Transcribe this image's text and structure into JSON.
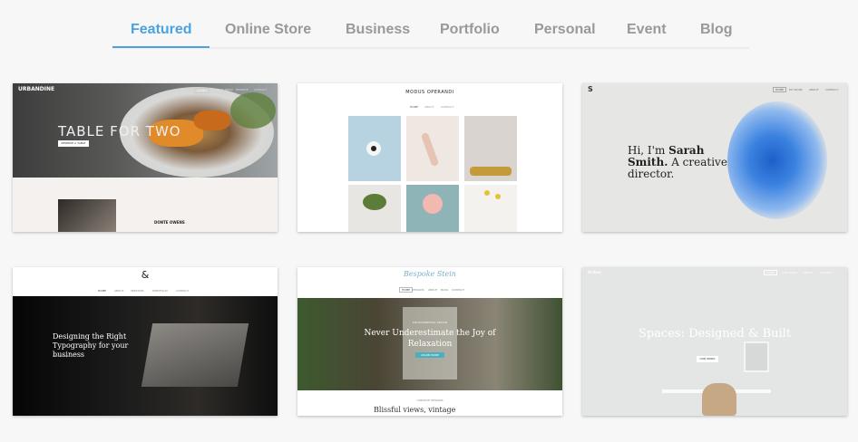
{
  "tabs": [
    {
      "label": "Featured",
      "active": true
    },
    {
      "label": "Online Store"
    },
    {
      "label": "Business"
    },
    {
      "label": "Portfolio"
    },
    {
      "label": "Personal"
    },
    {
      "label": "Event"
    },
    {
      "label": "Blog"
    }
  ],
  "colors": {
    "accent": "#4aa3e0",
    "tab_inactive": "#999999",
    "background": "#f7f7f7"
  },
  "templates": [
    {
      "name": "urbandine",
      "logo": "URBANDINE",
      "headline": "TABLE FOR TWO",
      "nav": [
        "HOME",
        "ABOUT",
        "MENU",
        "RESERVE",
        "CONTACT"
      ],
      "button": "RESERVE A TABLE",
      "subhead": "DONTE OWENS"
    },
    {
      "name": "modus-operandi",
      "logo": "MODUS OPERANDI",
      "nav": [
        "HOME",
        "ABOUT",
        "CONTACT"
      ]
    },
    {
      "name": "sarah",
      "logo": "S",
      "headline_plain": "Hi, I'm ",
      "headline_bold_1": "Sarah",
      "headline_bold_2": "Smith.",
      "headline_rest": "A creative director.",
      "nav": [
        "HOME",
        "MY WORK",
        "ABOUT",
        "CONTACT"
      ]
    },
    {
      "name": "typography",
      "logo": "&",
      "headline": "Designing the Right Typography for your business",
      "nav": [
        "HOME",
        "ABOUT",
        "SERVICES",
        "PORTFOLIO",
        "CONTACT"
      ],
      "caption": "VIEW PROJECTS"
    },
    {
      "name": "bespoke-stein",
      "logo": "Bespoke Stein",
      "headline": "Never Underestimate the Joy of Relaxation",
      "nav": [
        "HOME",
        "DESIGNS",
        "ABOUT",
        "BLOG",
        "CONTACT"
      ],
      "kicker": "ENVIRONMENTAL DESIGN",
      "button": "LEARN MORE",
      "footer_label": "CREATIVE DESIGNS",
      "footer_text": "Blissful views, vintage"
    },
    {
      "name": "spaces",
      "logo": "Oribus",
      "headline": "Spaces: Designed & Built",
      "nav": [
        "HOME",
        "OUR WORK",
        "ABOUT",
        "CONTACT"
      ],
      "button": "OUR WORK"
    }
  ]
}
